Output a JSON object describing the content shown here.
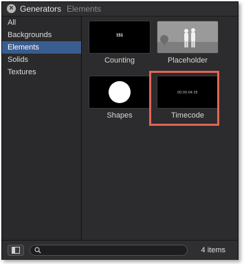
{
  "window": {
    "title": "Generators",
    "subtitle": "Elements",
    "close_icon": "close-icon"
  },
  "sidebar": {
    "items": [
      {
        "label": "All"
      },
      {
        "label": "Backgrounds"
      },
      {
        "label": "Elements",
        "selected": true
      },
      {
        "label": "Solids"
      },
      {
        "label": "Textures"
      }
    ]
  },
  "content": {
    "items": [
      {
        "label": "Counting",
        "thumb_text": "151"
      },
      {
        "label": "Placeholder"
      },
      {
        "label": "Shapes"
      },
      {
        "label": "Timecode",
        "thumb_text": "00:00:04:25",
        "highlighted": true
      }
    ],
    "highlight_color": "#e36555",
    "selection_color": "#3a5d8f"
  },
  "footer": {
    "toggle_icon": "sidebar-toggle-icon",
    "search_placeholder": "",
    "search_icon": "search-icon",
    "count": "4 items"
  }
}
